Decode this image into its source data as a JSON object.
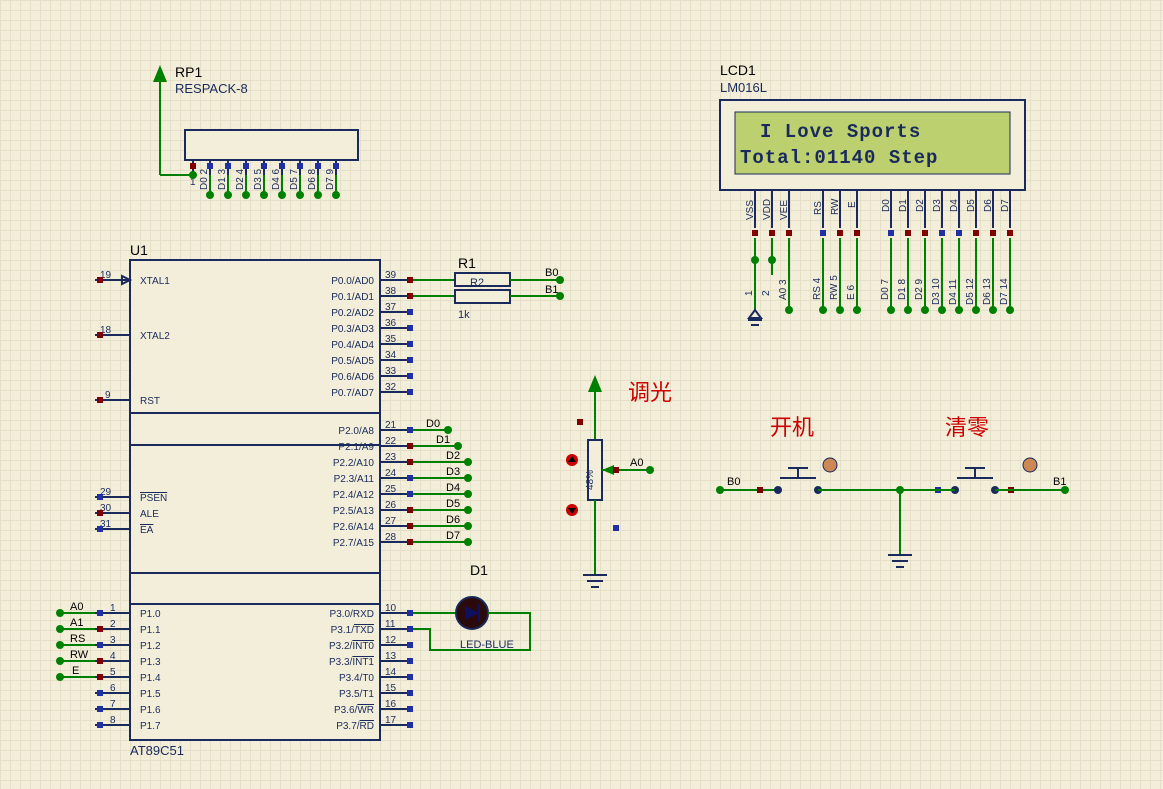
{
  "components": {
    "RP1": {
      "ref": "RP1",
      "part": "RESPACK-8",
      "pins": [
        "1",
        "D0 2",
        "D1 3",
        "D2 4",
        "D3 5",
        "D4 6",
        "D5 7",
        "D6 8",
        "D7 9"
      ]
    },
    "U1": {
      "ref": "U1",
      "part": "AT89C51",
      "left_pins": [
        {
          "num": "19",
          "name": "XTAL1"
        },
        {
          "num": "18",
          "name": "XTAL2"
        },
        {
          "num": "9",
          "name": "RST"
        },
        {
          "num": "29",
          "name": "PSEN",
          "ov": true
        },
        {
          "num": "30",
          "name": "ALE"
        },
        {
          "num": "31",
          "name": "EA",
          "ov": true
        },
        {
          "num": "1",
          "name": "P1.0"
        },
        {
          "num": "2",
          "name": "P1.1"
        },
        {
          "num": "3",
          "name": "P1.2"
        },
        {
          "num": "4",
          "name": "P1.3"
        },
        {
          "num": "5",
          "name": "P1.4"
        },
        {
          "num": "6",
          "name": "P1.5"
        },
        {
          "num": "7",
          "name": "P1.6"
        },
        {
          "num": "8",
          "name": "P1.7"
        }
      ],
      "right_pins": [
        {
          "num": "39",
          "name": "P0.0/AD0"
        },
        {
          "num": "38",
          "name": "P0.1/AD1"
        },
        {
          "num": "37",
          "name": "P0.2/AD2"
        },
        {
          "num": "36",
          "name": "P0.3/AD3"
        },
        {
          "num": "35",
          "name": "P0.4/AD4"
        },
        {
          "num": "34",
          "name": "P0.5/AD5"
        },
        {
          "num": "33",
          "name": "P0.6/AD6"
        },
        {
          "num": "32",
          "name": "P0.7/AD7"
        },
        {
          "num": "21",
          "name": "P2.0/A8"
        },
        {
          "num": "22",
          "name": "P2.1/A9"
        },
        {
          "num": "23",
          "name": "P2.2/A10"
        },
        {
          "num": "24",
          "name": "P2.3/A11"
        },
        {
          "num": "25",
          "name": "P2.4/A12"
        },
        {
          "num": "26",
          "name": "P2.5/A13"
        },
        {
          "num": "27",
          "name": "P2.6/A14"
        },
        {
          "num": "28",
          "name": "P2.7/A15"
        },
        {
          "num": "10",
          "name": "P3.0/RXD"
        },
        {
          "num": "11",
          "name": "P3.1/TXD",
          "ov_part": "TXD"
        },
        {
          "num": "12",
          "name": "P3.2/INT0",
          "ov_part": "INT0"
        },
        {
          "num": "13",
          "name": "P3.3/INT1",
          "ov_part": "INT1"
        },
        {
          "num": "14",
          "name": "P3.4/T0"
        },
        {
          "num": "15",
          "name": "P3.5/T1"
        },
        {
          "num": "16",
          "name": "P3.6/WR",
          "ov_part": "WR"
        },
        {
          "num": "17",
          "name": "P3.7/RD",
          "ov_part": "RD"
        }
      ],
      "left_nets": [
        "A0",
        "A1",
        "RS",
        "RW",
        "E"
      ]
    },
    "R1": {
      "ref": "R1",
      "sub": "R2",
      "value": "1k",
      "nets": [
        "B0",
        "B1"
      ]
    },
    "D1": {
      "ref": "D1",
      "part": "LED-BLUE"
    },
    "POT": {
      "value": "48%",
      "net": "A0",
      "label": "调光"
    },
    "BTN1": {
      "label": "开机",
      "net_left": "B0"
    },
    "BTN2": {
      "label": "清零",
      "net_right": "B1"
    },
    "LCD1": {
      "ref": "LCD1",
      "part": "LM016L",
      "line1": " I Love Sports",
      "line2": "Total:01140 Step",
      "bottom_pins": [
        "VSS",
        "VDD",
        "VEE",
        "RS",
        "RW",
        "E",
        "D0",
        "D1",
        "D2",
        "D3",
        "D4",
        "D5",
        "D6",
        "D7"
      ],
      "bottom_nets": [
        "1",
        "2",
        "A0 3",
        "RS 4",
        "RW 5",
        "E 6",
        "D0 7",
        "D1 8",
        "D2 9",
        "D3 10",
        "D4 11",
        "D5 12",
        "D6 13",
        "D7 14"
      ]
    },
    "P2_nets": [
      "D0",
      "D1",
      "D2",
      "D3",
      "D4",
      "D5",
      "D6",
      "D7"
    ]
  },
  "watermark": ""
}
